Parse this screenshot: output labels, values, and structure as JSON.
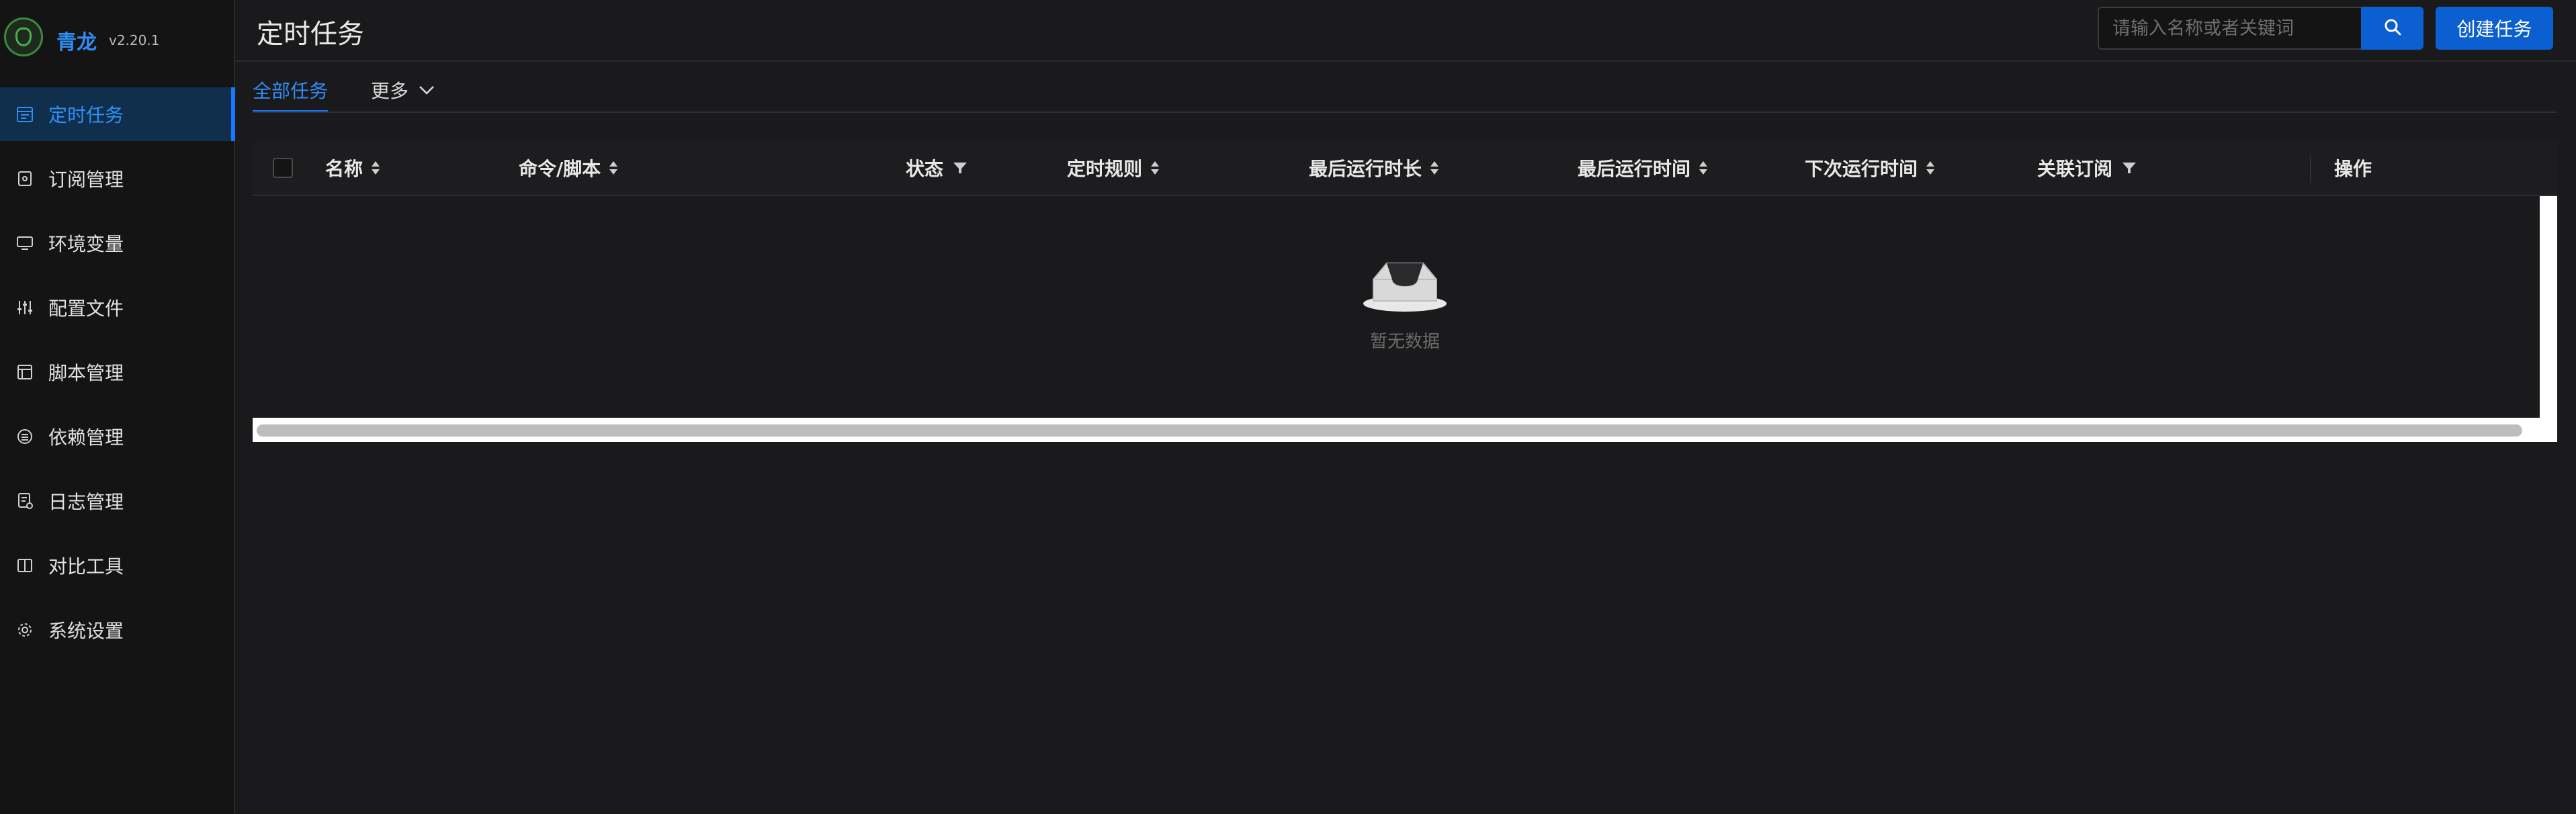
{
  "app": {
    "name": "青龙",
    "version": "v2.20.1"
  },
  "sidebar": {
    "items": [
      {
        "label": "定时任务",
        "icon": "calendar-task-icon",
        "active": true
      },
      {
        "label": "订阅管理",
        "icon": "subscription-icon"
      },
      {
        "label": "环境变量",
        "icon": "monitor-icon"
      },
      {
        "label": "配置文件",
        "icon": "sliders-icon"
      },
      {
        "label": "脚本管理",
        "icon": "code-file-icon"
      },
      {
        "label": "依赖管理",
        "icon": "dependency-icon"
      },
      {
        "label": "日志管理",
        "icon": "log-file-icon"
      },
      {
        "label": "对比工具",
        "icon": "diff-icon"
      },
      {
        "label": "系统设置",
        "icon": "gear-icon"
      }
    ]
  },
  "header": {
    "title": "定时任务",
    "search_placeholder": "请输入名称或者关键词",
    "create_label": "创建任务"
  },
  "tabs": [
    {
      "label": "全部任务",
      "active": true
    },
    {
      "label": "更多"
    }
  ],
  "table": {
    "columns": [
      {
        "label": "名称",
        "control": "sort"
      },
      {
        "label": "命令/脚本",
        "control": "sort"
      },
      {
        "label": "状态",
        "control": "filter"
      },
      {
        "label": "定时规则",
        "control": "sort"
      },
      {
        "label": "最后运行时长",
        "control": "sort"
      },
      {
        "label": "最后运行时间",
        "control": "sort"
      },
      {
        "label": "下次运行时间",
        "control": "sort"
      },
      {
        "label": "关联订阅",
        "control": "filter"
      },
      {
        "label": "操作"
      }
    ],
    "empty_text": "暂无数据"
  },
  "colors": {
    "accent": "#1677ff",
    "primary_button": "#0b5fd0",
    "sidebar_active": "#0f2f4d"
  }
}
